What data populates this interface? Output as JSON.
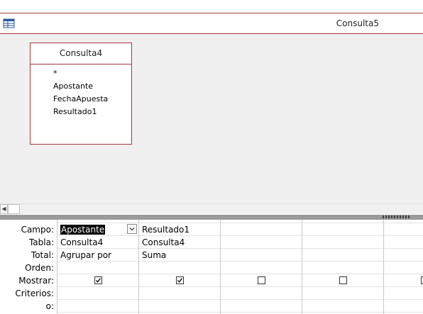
{
  "window": {
    "title": "Consulta5"
  },
  "field_list": {
    "title": "Consulta4",
    "fields": [
      "*",
      "Apostante",
      "FechaApuesta",
      "Resultado1"
    ]
  },
  "grid": {
    "row_labels": [
      "Campo:",
      "Tabla:",
      "Total:",
      "Orden:",
      "Mostrar:",
      "Criterios:",
      "o:"
    ],
    "columns": [
      {
        "campo": "Apostante",
        "tabla": "Consulta4",
        "total": "Agrupar por",
        "orden": "",
        "mostrar": true,
        "criterios": ""
      },
      {
        "campo": "Resultado1",
        "tabla": "Consulta4",
        "total": "Suma",
        "orden": "",
        "mostrar": true,
        "criterios": ""
      },
      {
        "campo": "",
        "tabla": "",
        "total": "",
        "orden": "",
        "mostrar": false,
        "criterios": ""
      },
      {
        "campo": "",
        "tabla": "",
        "total": "",
        "orden": "",
        "mostrar": false,
        "criterios": ""
      },
      {
        "campo": "",
        "tabla": "",
        "total": "",
        "orden": "",
        "mostrar": false,
        "criterios": ""
      }
    ]
  },
  "colors": {
    "accent": "#a4373a",
    "pane_bg": "#f0f0f0",
    "splitter": "#9a9a9a"
  },
  "icons": {
    "title": "query-design-icon"
  }
}
